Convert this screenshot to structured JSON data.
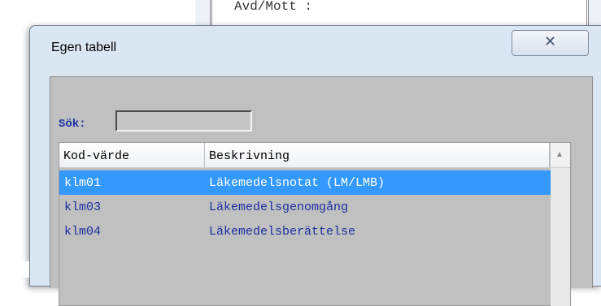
{
  "background_window": {
    "label": "Avd/Mott  :"
  },
  "dialog": {
    "title": "Egen tabell",
    "close_icon": "close-icon",
    "search": {
      "label": "Sök:",
      "value": ""
    },
    "columns": [
      "Kod-värde",
      "Beskrivning"
    ],
    "rows": [
      {
        "code": "klm01",
        "description": "Läkemedelsnotat (LM/LMB)",
        "selected": true
      },
      {
        "code": "klm03",
        "description": "Läkemedelsgenomgång",
        "selected": false
      },
      {
        "code": "klm04",
        "description": "Läkemedelsberättelse",
        "selected": false
      }
    ]
  },
  "colors": {
    "selection": "#3399ff",
    "row_text": "#1a2fa0",
    "client_bg": "#c0c0c0"
  }
}
